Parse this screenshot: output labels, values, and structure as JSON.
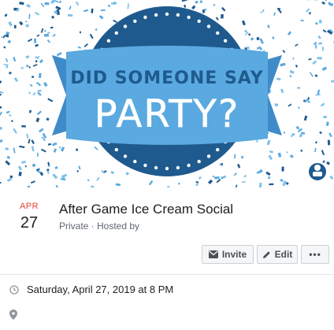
{
  "cover": {
    "line1": "DID SOMEONE SAY",
    "line2": "PARTY?",
    "colors": {
      "dark_blue": "#1f5a8e",
      "light_blue": "#5aa9e0",
      "confetti_light": "#7cc0ea"
    },
    "logo_icon": "mascot-badge-icon"
  },
  "event": {
    "month": "APR",
    "day": "27",
    "title": "After Game Ice Cream Social",
    "meta": "Private · Hosted by"
  },
  "actions": {
    "invite_label": "Invite",
    "edit_label": "Edit",
    "more_label": "•••"
  },
  "details": {
    "time_text": "Saturday, April 27, 2019 at 8 PM",
    "time_icon": "clock-icon",
    "location_icon": "map-pin-icon"
  }
}
